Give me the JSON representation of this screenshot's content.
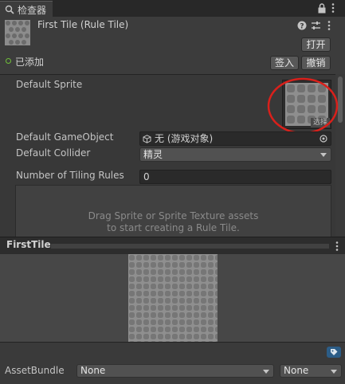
{
  "tab": {
    "label": "检查器",
    "icon": "search-icon"
  },
  "tab_buttons": {
    "lock": "lock-icon",
    "menu": "more-vert-icon"
  },
  "header": {
    "title": "First Tile (Rule Tile)",
    "open_button": "打开",
    "added_label": "已添加",
    "sign_in_button": "签入",
    "revert_button": "撤销",
    "icons": [
      "help-icon",
      "settings-sliders-icon",
      "more-vert-icon"
    ]
  },
  "fields": {
    "default_sprite_label": "Default Sprite",
    "select_button": "选择",
    "default_gameobject_label": "Default GameObject",
    "default_gameobject_value": "无 (游戏对象)",
    "default_collider_label": "Default Collider",
    "default_collider_value": "精灵",
    "tiling_rules_label": "Number of Tiling Rules",
    "tiling_rules_value": "0"
  },
  "rules_box": {
    "line1": "Drag Sprite or Sprite Texture assets",
    "line2": "to start creating a Rule Tile."
  },
  "preview": {
    "title": "FirstTile"
  },
  "asset_bundle": {
    "label": "AssetBundle",
    "name_value": "None",
    "variant_value": "None"
  },
  "colors": {
    "annotation_circle": "#d9201b",
    "added_dot": "#6fbf3a"
  }
}
